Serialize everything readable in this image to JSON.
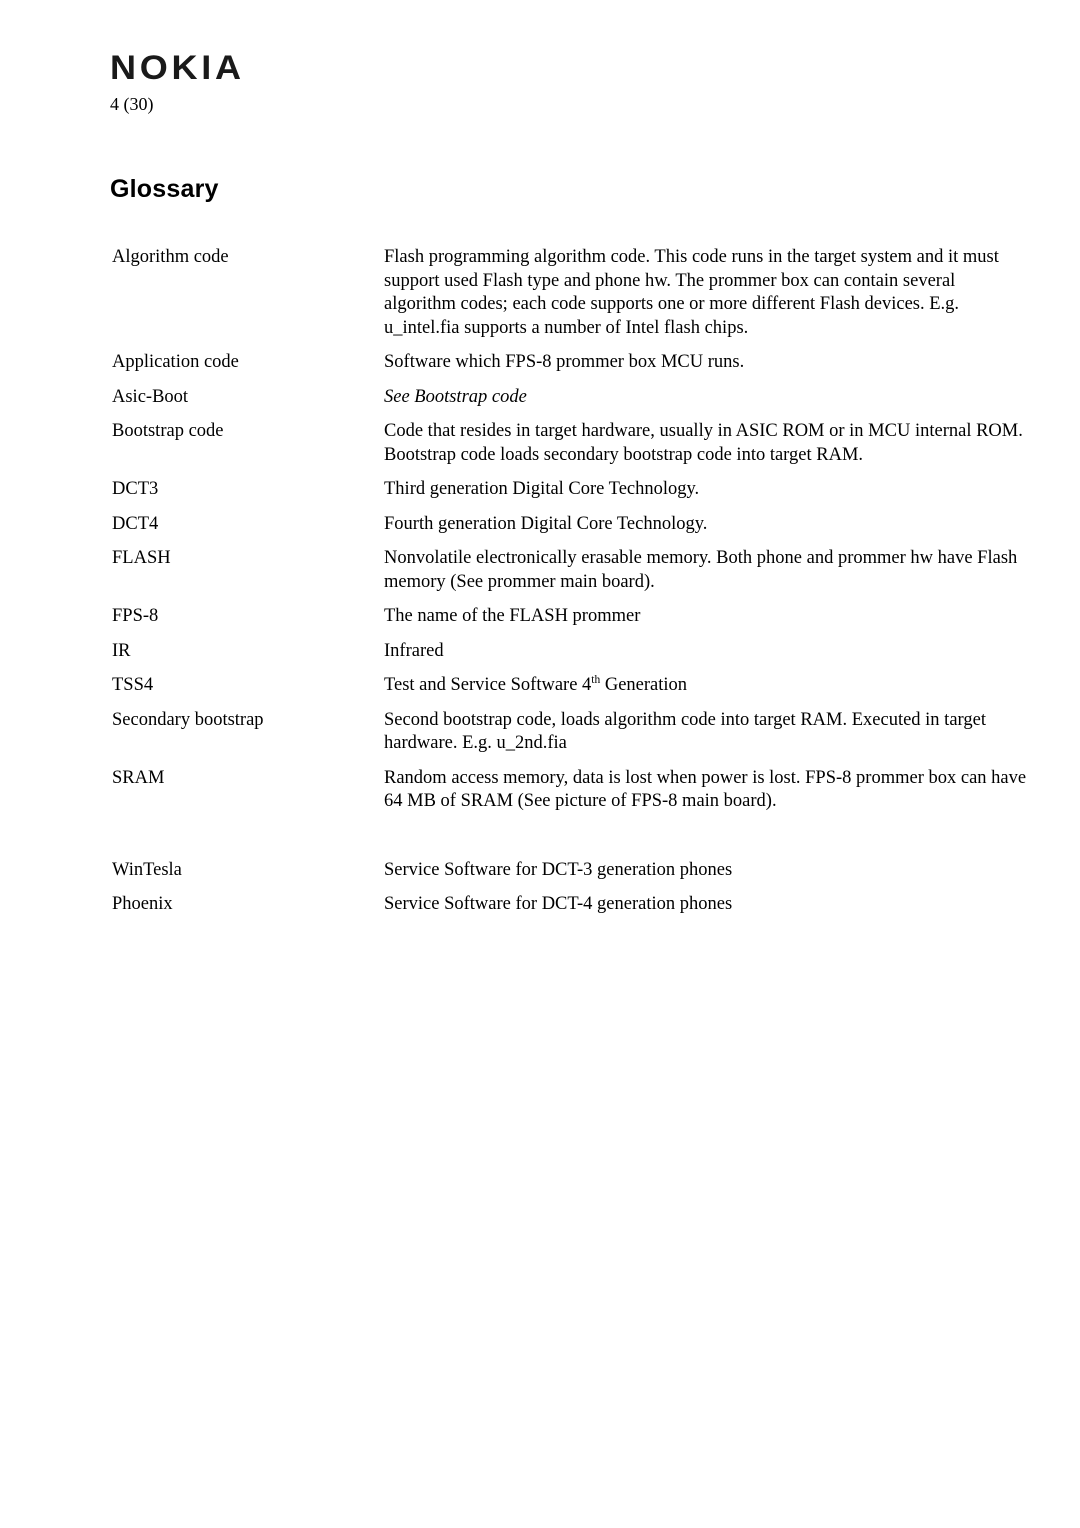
{
  "header": {
    "logo_text": "NOKIA",
    "logo_icon": "nokia-wordmark",
    "page_number": "4 (30)"
  },
  "title": "Glossary",
  "glossary": {
    "entries": [
      {
        "term": "Algorithm code",
        "definition": "Flash programming algorithm code. This code runs in the target system and it must support used Flash type and phone hw. The prommer box can contain several algorithm codes; each code supports one or more different Flash devices. E.g. u_intel.fia supports a number of Intel flash chips.",
        "style": "normal"
      },
      {
        "term": "Application code",
        "definition": "Software which FPS-8 prommer box MCU runs.",
        "style": "normal"
      },
      {
        "term": "Asic-Boot",
        "definition": "See Bootstrap code",
        "style": "italic"
      },
      {
        "term": "Bootstrap code",
        "definition": "Code that resides in target hardware, usually in ASIC ROM or in MCU internal ROM. Bootstrap code loads secondary bootstrap code into target RAM.",
        "style": "normal"
      },
      {
        "term": "DCT3",
        "definition": "Third generation Digital Core Technology.",
        "style": "normal"
      },
      {
        "term": "DCT4",
        "definition": "Fourth generation Digital Core Technology.",
        "style": "normal"
      },
      {
        "term": "FLASH",
        "definition": "Nonvolatile electronically erasable memory. Both phone and prommer hw have Flash memory (See prommer main board).",
        "style": "normal"
      },
      {
        "term": "FPS-8",
        "definition": "The name of the FLASH prommer",
        "style": "normal"
      },
      {
        "term": "IR",
        "definition": "Infrared",
        "style": "normal"
      },
      {
        "term": "TSS4",
        "definition_prefix": "Test and Service Software 4",
        "definition_superscript": "th",
        "definition_suffix": " Generation",
        "style": "superscript"
      },
      {
        "term": "Secondary bootstrap",
        "definition": "Second bootstrap code, loads algorithm code into target RAM. Executed in target hardware. E.g. u_2nd.fia",
        "style": "normal"
      },
      {
        "term": "SRAM",
        "definition": "Random access memory, data is lost when power is lost. FPS-8 prommer box can have 64 MB of SRAM (See picture of FPS-8 main board).",
        "style": "normal"
      },
      {
        "term": "WinTesla",
        "definition": "Service Software for DCT-3 generation phones",
        "style": "normal"
      },
      {
        "term": "Phoenix",
        "definition": "Service Software for DCT-4 generation phones",
        "style": "normal"
      }
    ]
  },
  "colors": {
    "text": "#000000",
    "logo": "#1a1a1a",
    "background": "#ffffff"
  }
}
